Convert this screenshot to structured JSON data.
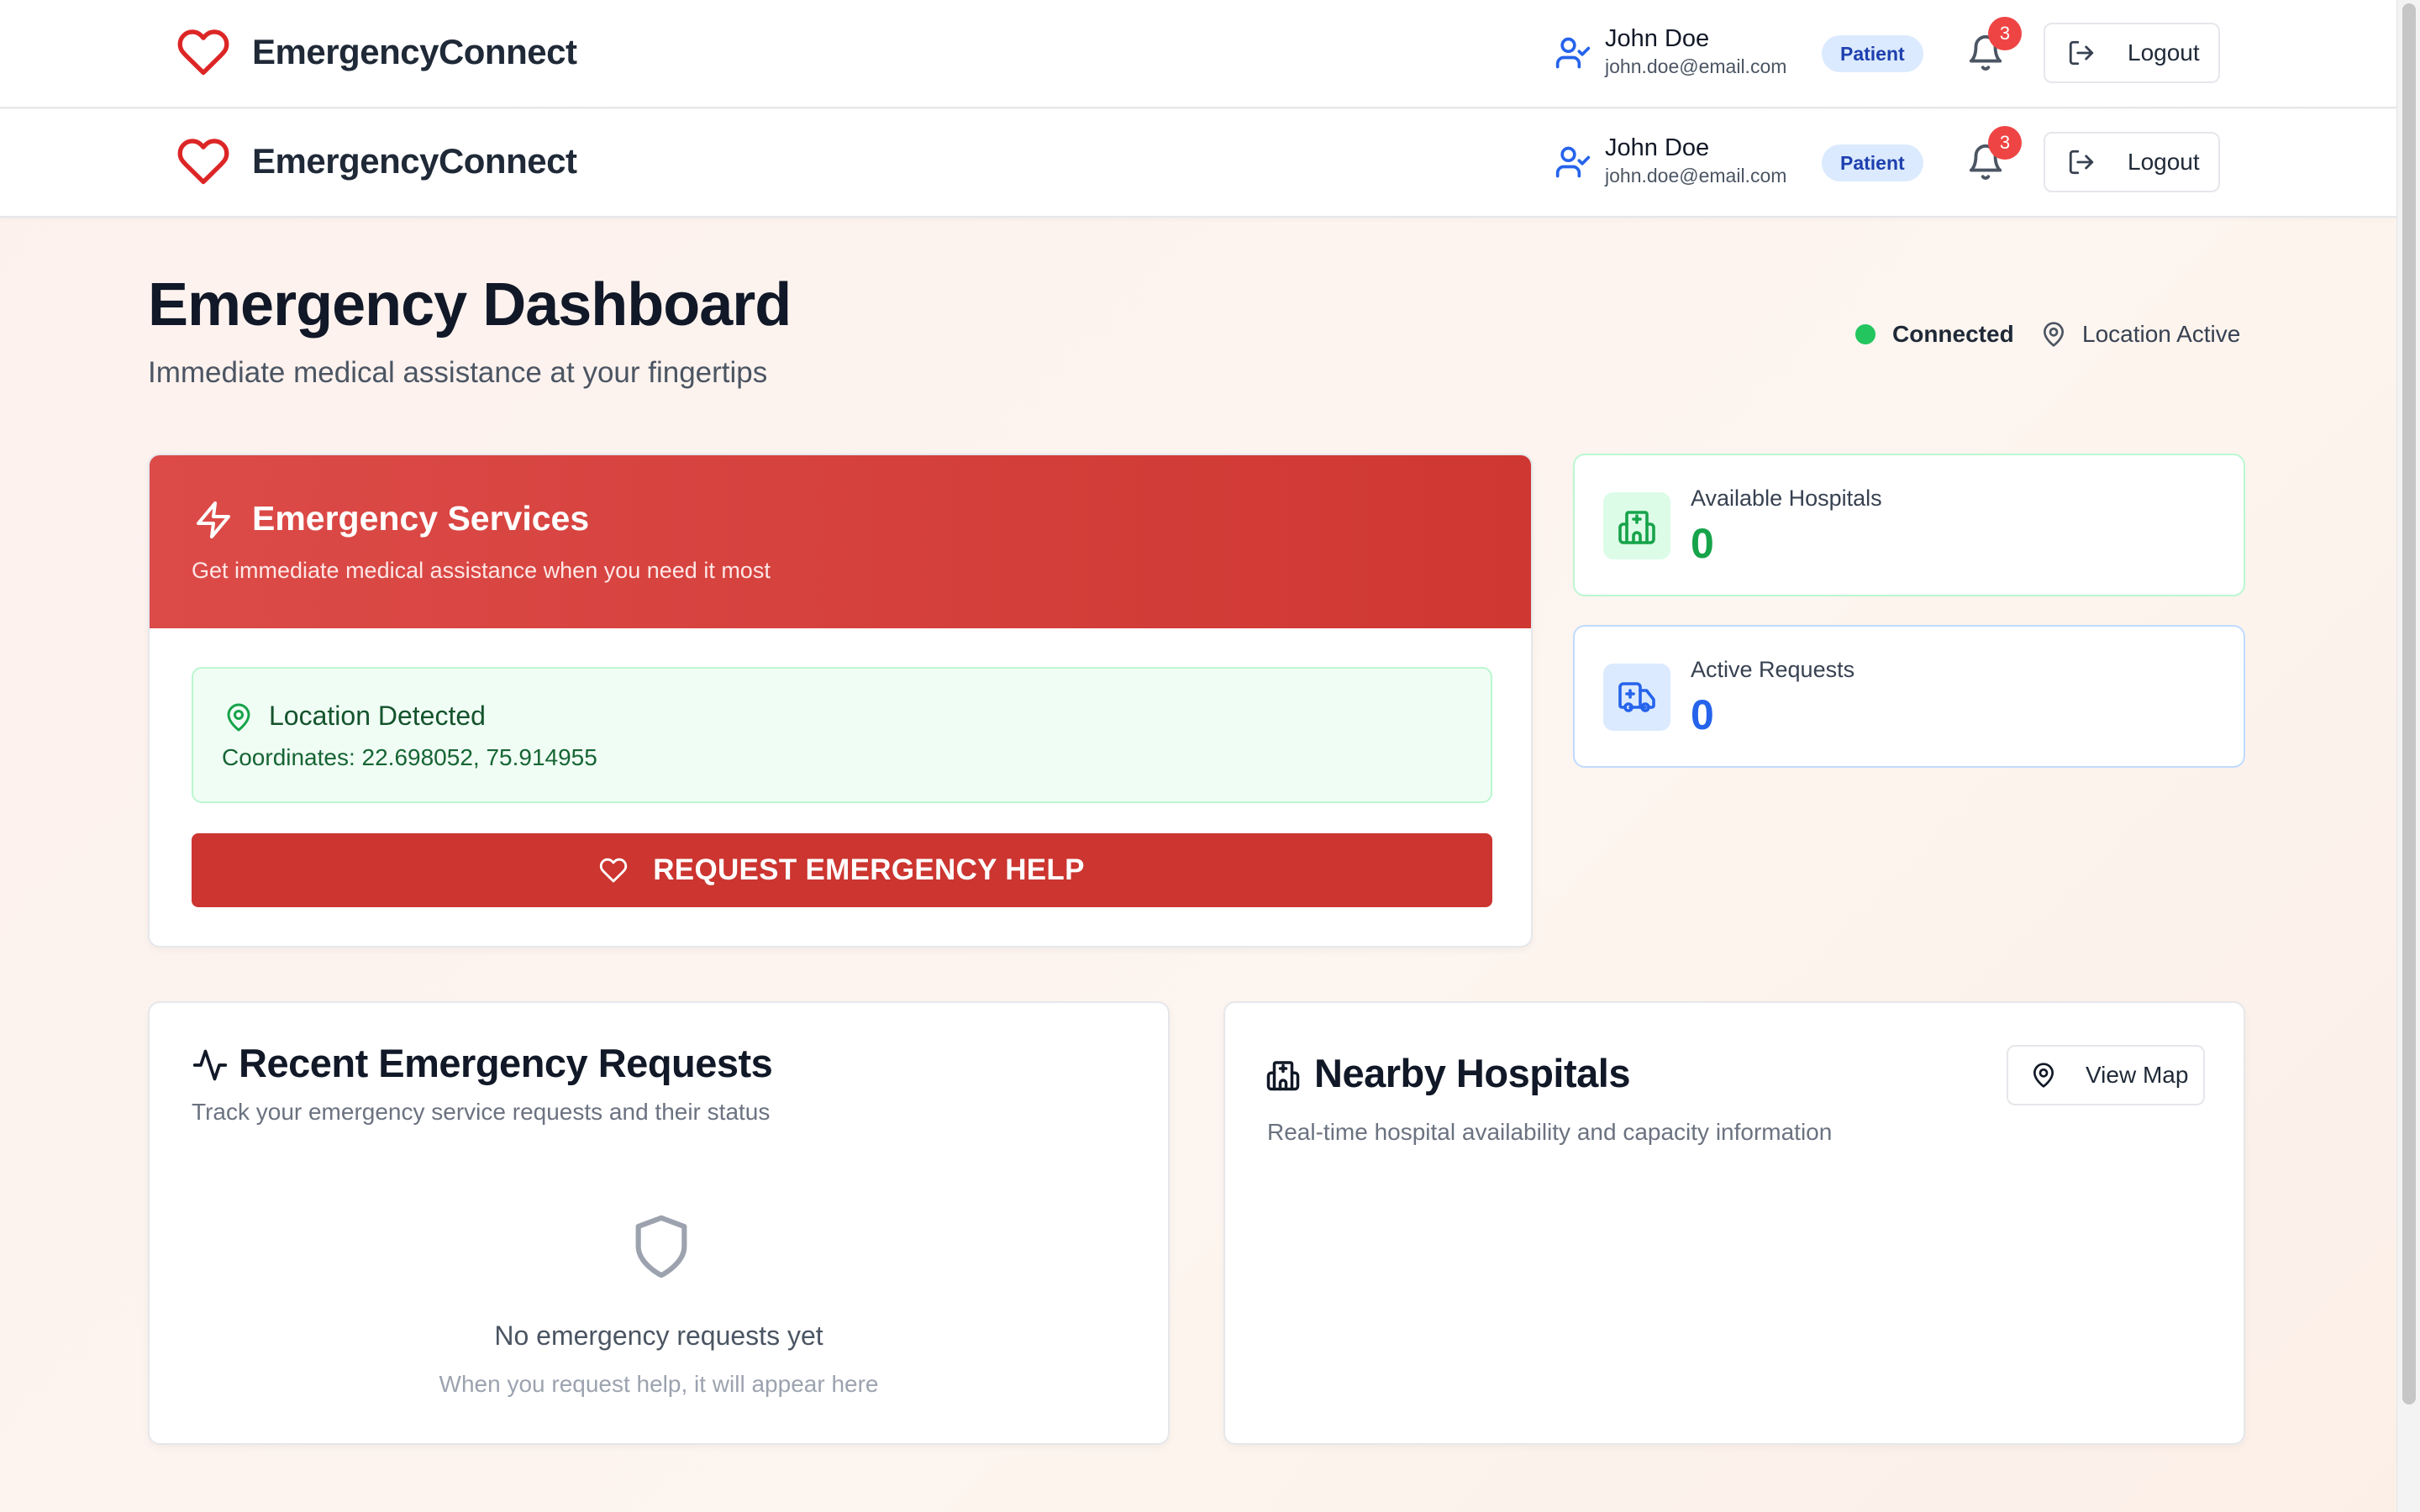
{
  "app": {
    "name": "EmergencyConnect"
  },
  "user": {
    "name": "John Doe",
    "email": "john.doe@email.com",
    "role": "Patient",
    "notifications": "3",
    "logout_label": "Logout"
  },
  "dashboard": {
    "title": "Emergency Dashboard",
    "subtitle": "Immediate medical assistance at your fingertips",
    "connection_status": "Connected",
    "location_status": "Location Active"
  },
  "emergency": {
    "title": "Emergency Services",
    "description": "Get immediate medical assistance when you need it most",
    "location_title": "Location Detected",
    "coordinates": "Coordinates: 22.698052, 75.914955",
    "request_label": "REQUEST EMERGENCY HELP"
  },
  "stats": {
    "hospitals_label": "Available Hospitals",
    "hospitals_value": "0",
    "requests_label": "Active Requests",
    "requests_value": "0"
  },
  "recent": {
    "title": "Recent Emergency Requests",
    "description": "Track your emergency service requests and their status",
    "empty_title": "No emergency requests yet",
    "empty_desc": "When you request help, it will appear here"
  },
  "nearby": {
    "title": "Nearby Hospitals",
    "description": "Real-time hospital availability and capacity information",
    "view_map_label": "View Map"
  },
  "colors": {
    "brand_red": "#cc3530",
    "success_green": "#16a34a",
    "info_blue": "#2563eb"
  }
}
